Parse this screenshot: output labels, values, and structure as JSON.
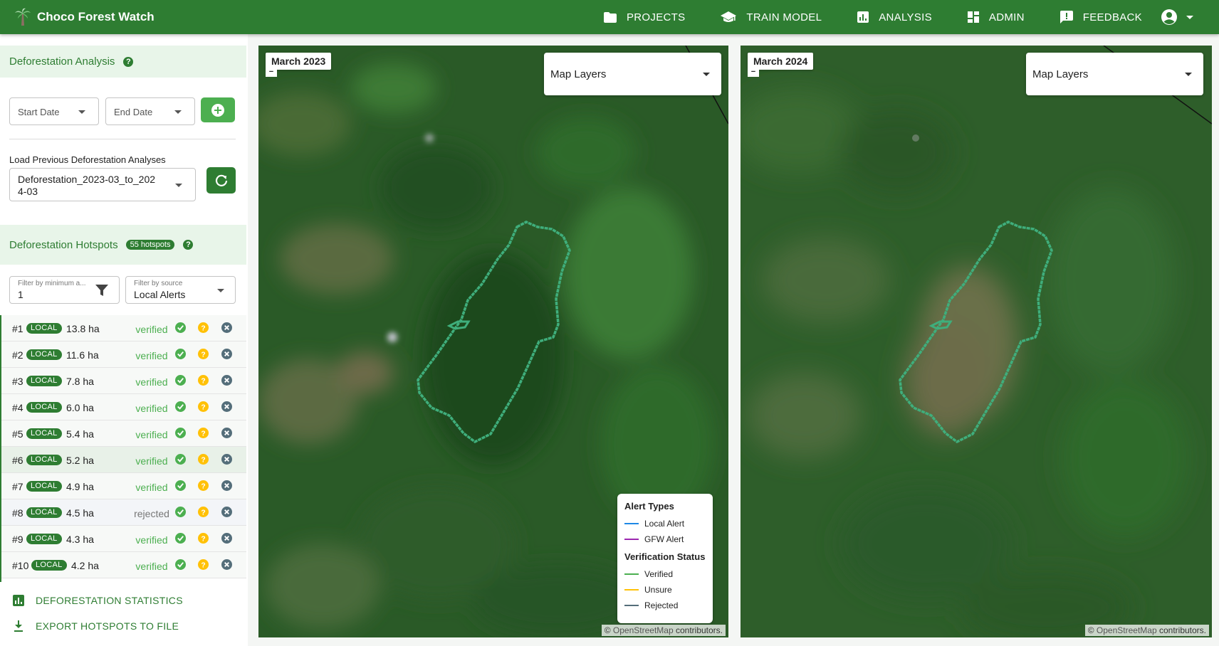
{
  "app": {
    "title": "Choco Forest Watch"
  },
  "nav": [
    {
      "label": "PROJECTS",
      "icon": "folder-icon"
    },
    {
      "label": "TRAIN MODEL",
      "icon": "school-icon"
    },
    {
      "label": "ANALYSIS",
      "icon": "chart-icon"
    },
    {
      "label": "ADMIN",
      "icon": "dashboard-icon"
    },
    {
      "label": "FEEDBACK",
      "icon": "feedback-icon"
    }
  ],
  "analysis": {
    "title": "Deforestation Analysis",
    "start_date_placeholder": "Start Date",
    "end_date_placeholder": "End Date",
    "load_label": "Load Previous Deforestation Analyses",
    "selected_analysis": "Deforestation_2023-03_to_2024-03"
  },
  "hotspots": {
    "title": "Deforestation Hotspots",
    "count_badge": "55 hotspots",
    "min_area_label": "Filter by minimum a...",
    "min_area_value": "1",
    "source_label": "Filter by source",
    "source_value": "Local Alerts",
    "rows": [
      {
        "rank": "#1",
        "source": "LOCAL",
        "area": "13.8 ha",
        "status": "verified"
      },
      {
        "rank": "#2",
        "source": "LOCAL",
        "area": "11.6 ha",
        "status": "verified"
      },
      {
        "rank": "#3",
        "source": "LOCAL",
        "area": "7.8 ha",
        "status": "verified"
      },
      {
        "rank": "#4",
        "source": "LOCAL",
        "area": "6.0 ha",
        "status": "verified"
      },
      {
        "rank": "#5",
        "source": "LOCAL",
        "area": "5.4 ha",
        "status": "verified"
      },
      {
        "rank": "#6",
        "source": "LOCAL",
        "area": "5.2 ha",
        "status": "verified"
      },
      {
        "rank": "#7",
        "source": "LOCAL",
        "area": "4.9 ha",
        "status": "verified"
      },
      {
        "rank": "#8",
        "source": "LOCAL",
        "area": "4.5 ha",
        "status": "rejected"
      },
      {
        "rank": "#9",
        "source": "LOCAL",
        "area": "4.3 ha",
        "status": "verified"
      },
      {
        "rank": "#10",
        "source": "LOCAL",
        "area": "4.2 ha",
        "status": "verified"
      }
    ]
  },
  "actions": {
    "stats_label": "DEFORESTATION STATISTICS",
    "export_label": "EXPORT HOTSPOTS TO FILE"
  },
  "maps": {
    "left_date": "March 2023",
    "right_date": "March 2024",
    "layers_label": "Map Layers",
    "zoom_out": "−",
    "attribution_prefix": "©",
    "attribution_link": "OpenStreetMap",
    "attribution_suffix": "contributors."
  },
  "legend": {
    "alert_title": "Alert Types",
    "alert_items": [
      {
        "label": "Local Alert",
        "color": "#1e88e5"
      },
      {
        "label": "GFW Alert",
        "color": "#9c27b0"
      }
    ],
    "status_title": "Verification Status",
    "status_items": [
      {
        "label": "Verified",
        "color": "#4caf50"
      },
      {
        "label": "Unsure",
        "color": "#ffc107"
      },
      {
        "label": "Rejected",
        "color": "#546e7a"
      }
    ]
  },
  "colors": {
    "primary": "#2e7d32",
    "accent": "#4caf50",
    "unsure": "#ffc107",
    "rejected": "#546e7a",
    "polygon": "#3fae7c"
  }
}
